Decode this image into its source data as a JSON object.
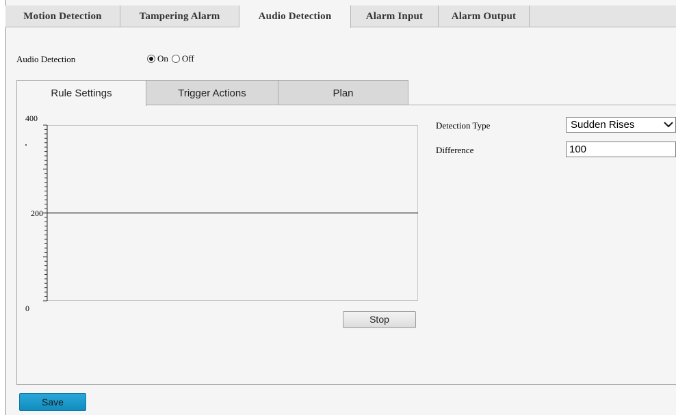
{
  "top_tabs": [
    {
      "label": "Motion Detection"
    },
    {
      "label": "Tampering Alarm"
    },
    {
      "label": "Audio Detection"
    },
    {
      "label": "Alarm Input"
    },
    {
      "label": "Alarm Output"
    }
  ],
  "active_top_tab": "Audio Detection",
  "audio_detection": {
    "label": "Audio Detection",
    "on_label": "On",
    "off_label": "Off",
    "selected": "On"
  },
  "sub_tabs": [
    {
      "label": "Rule Settings"
    },
    {
      "label": "Trigger Actions"
    },
    {
      "label": "Plan"
    }
  ],
  "active_sub_tab": "Rule Settings",
  "chart": {
    "y_max_label": "400",
    "y_mid_label": "200",
    "y_min_label": "0",
    "ylim": [
      0,
      400
    ],
    "threshold": 200,
    "stop_label": "Stop"
  },
  "form": {
    "detection_type_label": "Detection Type",
    "detection_type_value": "Sudden Rises",
    "difference_label": "Difference",
    "difference_value": "100"
  },
  "save_label": "Save",
  "colors": {
    "accent": "#1a9ad0",
    "tab_bar": "#e4e4e4",
    "background": "#f5f5f5"
  }
}
